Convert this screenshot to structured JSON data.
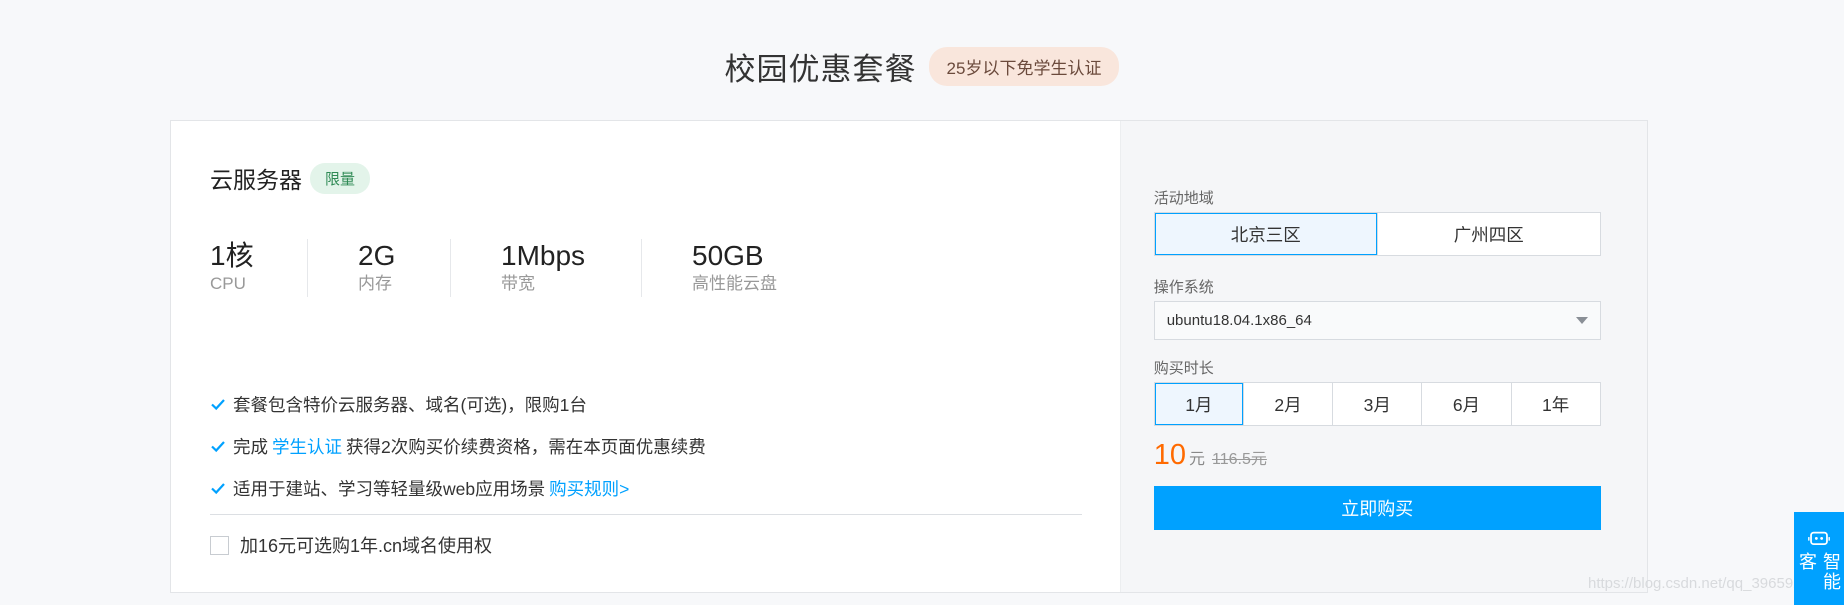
{
  "header": {
    "title": "校园优惠套餐",
    "badge": "25岁以下免学生认证"
  },
  "product": {
    "title": "云服务器",
    "badge": "限量",
    "specs": [
      {
        "value": "1核",
        "label": "CPU"
      },
      {
        "value": "2G",
        "label": "内存"
      },
      {
        "value": "1Mbps",
        "label": "带宽"
      },
      {
        "value": "50GB",
        "label": "高性能云盘"
      }
    ],
    "features": [
      {
        "text": "套餐包含特价云服务器、域名(可选)，限购1台"
      },
      {
        "pre": "完成",
        "link": "学生认证",
        "post": "获得2次购买价续费资格，需在本页面优惠续费"
      },
      {
        "pre": "适用于建站、学习等轻量级web应用场景",
        "link": "购买规则>"
      }
    ],
    "addon_label": "加16元可选购1年.cn域名使用权"
  },
  "config": {
    "region_label": "活动地域",
    "regions": [
      "北京三区",
      "广州四区"
    ],
    "region_selected": "北京三区",
    "os_label": "操作系统",
    "os_value": "ubuntu18.04.1x86_64",
    "duration_label": "购买时长",
    "durations": [
      "1月",
      "2月",
      "3月",
      "6月",
      "1年"
    ],
    "duration_selected": "1月",
    "price": "10",
    "price_unit": "元",
    "price_old": "116.5元",
    "buy_label": "立即购买"
  },
  "assistant": {
    "label": "智能客"
  },
  "watermark": "https://blog.csdn.net/qq_39659226",
  "colors": {
    "accent": "#00a1ff",
    "price": "#ff6a00",
    "limited_badge_bg": "#e3f4ea",
    "header_badge_bg": "#f9e6dc"
  },
  "icons": {
    "feature_check": "check-icon",
    "os_dropdown": "caret-down-icon",
    "assistant": "robot-icon"
  }
}
